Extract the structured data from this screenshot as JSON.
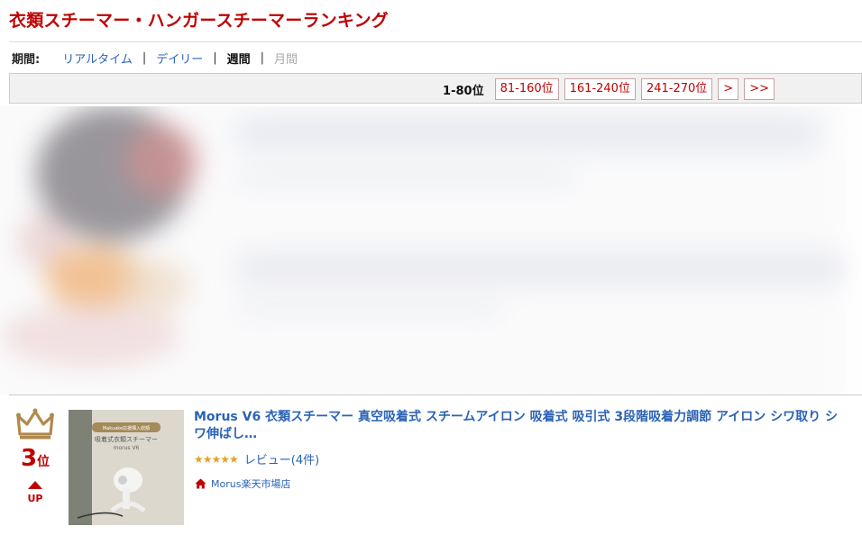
{
  "page_title": "衣類スチーマー・ハンガースチーマーランキング",
  "period": {
    "label": "期間:",
    "options": [
      "リアルタイム",
      "デイリー",
      "週間",
      "月間"
    ],
    "selected": "週間"
  },
  "pager": {
    "current": "1-80位",
    "pages": [
      "81-160位",
      "161-240位",
      "241-270位",
      ">",
      ">>"
    ]
  },
  "item": {
    "rank_number": "3",
    "rank_suffix": "位",
    "rank_change": "UP",
    "title": "Morus V6 衣類スチーマー 真空吸着式 スチームアイロン 吸着式 吸引式 3段階吸着力調節 アイロン シワ取り シワ伸ばし…",
    "rating_stars": "★★★★★",
    "review_label": "レビュー(4件)",
    "shop": "Morus楽天市場店",
    "thumb_badge": "Makuake応援購入総額",
    "thumb_caption": "吸着式衣類スチーマー",
    "thumb_model": "morus V6"
  },
  "colors": {
    "brand_red": "#bf0000",
    "link_blue": "#2b63b6",
    "crown_gold": "#b08a4c",
    "star_gold": "#e0a32e"
  },
  "icons": [
    "crown-icon",
    "up-arrow-icon",
    "shop-home-icon"
  ]
}
